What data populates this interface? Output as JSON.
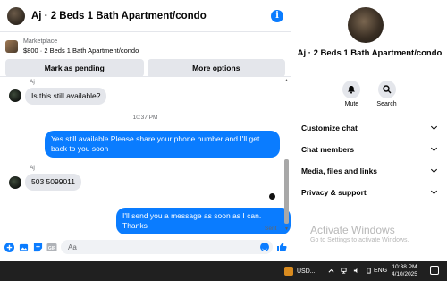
{
  "header": {
    "title": "Aj · 2 Beds 1 Bath Apartment/condo"
  },
  "listing": {
    "source": "Marketplace",
    "item": "$800 · 2 Beds 1 Bath Apartment/condo"
  },
  "actions": {
    "mark_pending": "Mark as pending",
    "more_options": "More options"
  },
  "messages": {
    "sender1": "Aj",
    "msg1": "Is this still available?",
    "time1": "10:37 PM",
    "out1": "Yes still available Please share your phone number and I'll get back to you soon",
    "sender2": "Aj",
    "msg2": "503 5099011",
    "out2": "I'll send you a message as soon as I can. Thanks",
    "status": "Sent"
  },
  "composer": {
    "placeholder": "Aa"
  },
  "info_panel": {
    "name": "Aj · 2 Beds 1 Bath Apartment/condo",
    "mute_label": "Mute",
    "search_label": "Search",
    "menu": [
      {
        "label": "Customize chat"
      },
      {
        "label": "Chat members"
      },
      {
        "label": "Media, files and links"
      },
      {
        "label": "Privacy & support"
      }
    ]
  },
  "watermark": {
    "title": "Activate Windows",
    "subtitle": "Go to Settings to activate Windows."
  },
  "taskbar": {
    "widget": "USD...",
    "language": "ENG",
    "time": "10:38 PM",
    "date": "4/10/2025"
  },
  "colors": {
    "accent": "#0a7cff",
    "bubble_in": "#e4e6eb",
    "taskbar": "#202020"
  }
}
